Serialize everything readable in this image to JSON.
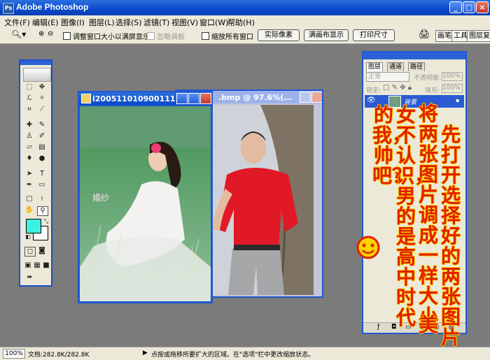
{
  "app": {
    "title": "Adobe Photoshop",
    "icon": "photoshop-icon"
  },
  "window_buttons": {
    "minimize": "_",
    "maximize": "□",
    "close": "×"
  },
  "menu": [
    "文件(F)",
    "编辑(E)",
    "图像(I)",
    "图层(L)",
    "选择(S)",
    "滤镜(T)",
    "视图(V)",
    "窗口(W)",
    "帮助(H)"
  ],
  "options_bar": {
    "tool_icon": "zoom-tool-icon",
    "resize_windows": "调整窗口大小以满屏显示",
    "ignore_palettes": "忽略调板",
    "zoom_all": "缩放所有窗口",
    "actual_pixels": "实际像素",
    "fit_on_screen": "满画布显示",
    "print_size": "打印尺寸",
    "tabs": [
      "画笔",
      "工具",
      "图层复"
    ]
  },
  "doc1": {
    "title": "i200511010900111..."
  },
  "doc2": {
    "title": ".bmp @ 97.6%(..."
  },
  "layers_palette": {
    "tabs": [
      "图层",
      "通道",
      "路径"
    ],
    "blend_mode": "正常",
    "opacity_label": "不透明度:",
    "opacity_value": "100%",
    "lock_label": "锁定:",
    "fill_label": "填充:",
    "fill_value": "100%",
    "layer_name": "背景"
  },
  "annotation": {
    "columns": [
      "先打开选择好的两张图片",
      "将两张图片调成一样大小",
      "美",
      "女不认识，男的是高中时代",
      "的我，帅吧？"
    ],
    "emoji": "smiley-face-icon"
  },
  "colors": {
    "foreground": "#3ff2df",
    "background": "#ffffff",
    "accent": "#2057d1"
  },
  "status": {
    "zoom": "100%",
    "doc_size": "文档:282.8K/282.8K",
    "hint": "点按或拖移所要扩大的区域。在\"选项\"栏中更改缩放状态。"
  }
}
